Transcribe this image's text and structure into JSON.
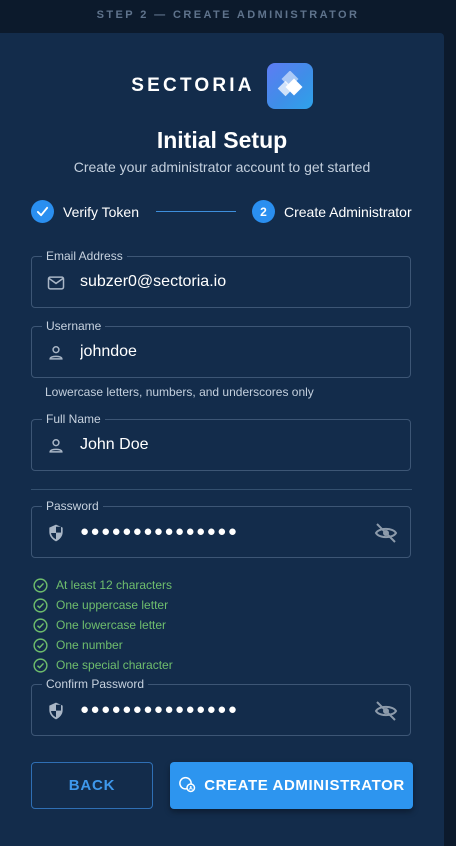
{
  "banner": {
    "text": "STEP 2 — CREATE ADMINISTRATOR"
  },
  "brand": {
    "name": "SECTORIA"
  },
  "header": {
    "title": "Initial Setup",
    "subtitle": "Create your administrator account to get started"
  },
  "stepper": {
    "steps": [
      {
        "label": "Verify Token",
        "status": "complete",
        "icon": "check-icon"
      },
      {
        "label": "Create Administrator",
        "status": "active",
        "number": "2"
      }
    ]
  },
  "form": {
    "email": {
      "label": "Email Address",
      "value": "subzer0@sectoria.io",
      "icon": "mail-icon"
    },
    "username": {
      "label": "Username",
      "value": "johndoe",
      "icon": "person-icon",
      "helper": "Lowercase letters, numbers, and underscores only"
    },
    "full_name": {
      "label": "Full Name",
      "value": "John Doe",
      "icon": "person-icon"
    },
    "password": {
      "label": "Password",
      "value": "●●●●●●●●●●●●●●●",
      "icon": "shield-icon",
      "toggle_icon": "eye-off-icon"
    },
    "requirements": [
      {
        "text": "At least 12 characters",
        "met": true
      },
      {
        "text": "One uppercase letter",
        "met": true
      },
      {
        "text": "One lowercase letter",
        "met": true
      },
      {
        "text": "One number",
        "met": true
      },
      {
        "text": "One special character",
        "met": true
      }
    ],
    "confirm_password": {
      "label": "Confirm Password",
      "value": "●●●●●●●●●●●●●●●",
      "icon": "shield-icon",
      "toggle_icon": "eye-off-icon"
    }
  },
  "actions": {
    "back_label": "BACK",
    "create_label": "CREATE ADMINISTRATOR",
    "create_icon": "admin-shield-icon"
  },
  "colors": {
    "background": "#0c1a2c",
    "card": "#132c4b",
    "accent": "#2d95ef",
    "success": "#6fbe6d"
  }
}
